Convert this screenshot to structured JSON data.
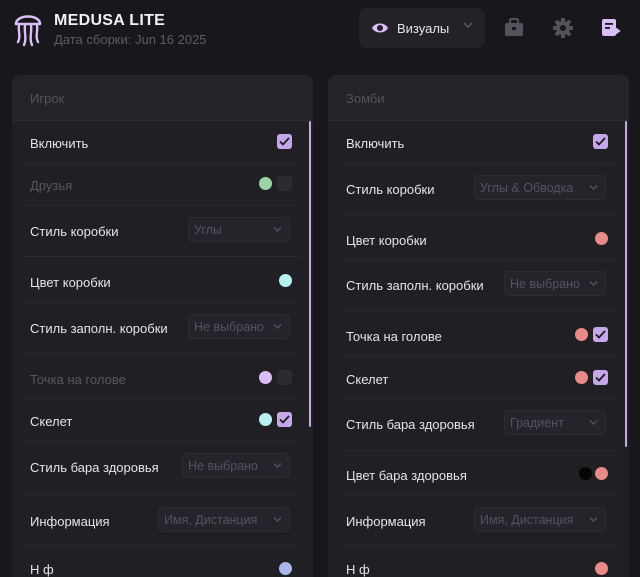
{
  "app": {
    "title": "MEDUSA LITE",
    "build": "Дата сборки: Jun 16 2025"
  },
  "header": {
    "tab_label": "Визуалы",
    "tab_icon": "eye-icon",
    "icons": [
      "briefcase-icon",
      "gear-icon",
      "receipt-icon"
    ]
  },
  "colors": {
    "accent": "#c7a7ea",
    "bg": "#18171b",
    "panel": "#201f24"
  },
  "player": {
    "title": "Игрок",
    "enable": "Включить",
    "friends": "Друзья",
    "box_style": "Стиль коробки",
    "box_style_value": "Углы",
    "box_color": "Цвет коробки",
    "box_fill": "Стиль заполн. коробки",
    "box_fill_value": "Не выбрано",
    "head_dot": "Точка на голове",
    "skeleton": "Скелет",
    "health_bar": "Стиль бара здоровья",
    "health_bar_value": "Не выбрано",
    "info": "Информация",
    "info_value": "Имя, Дистанция",
    "next_label": "Н                 ф"
  },
  "zombie": {
    "title": "Зомби",
    "enable": "Включить",
    "box_style": "Стиль коробки",
    "box_style_value": "Углы & Обводка",
    "box_color": "Цвет коробки",
    "box_fill": "Стиль заполн. коробки",
    "box_fill_value": "Не выбрано",
    "head_dot": "Точка на голове",
    "skeleton": "Скелет",
    "health_bar": "Стиль бара здоровья",
    "health_bar_value": "Градиент",
    "health_color": "Цвет бара здоровья",
    "info": "Информация",
    "info_value": "Имя, Дистанция",
    "next_label": "Н                 ф"
  },
  "states": {
    "player": {
      "enable": true,
      "friends": false,
      "head_dot": false,
      "skeleton": true
    },
    "zombie": {
      "enable": true,
      "head_dot": true,
      "skeleton": true
    }
  }
}
